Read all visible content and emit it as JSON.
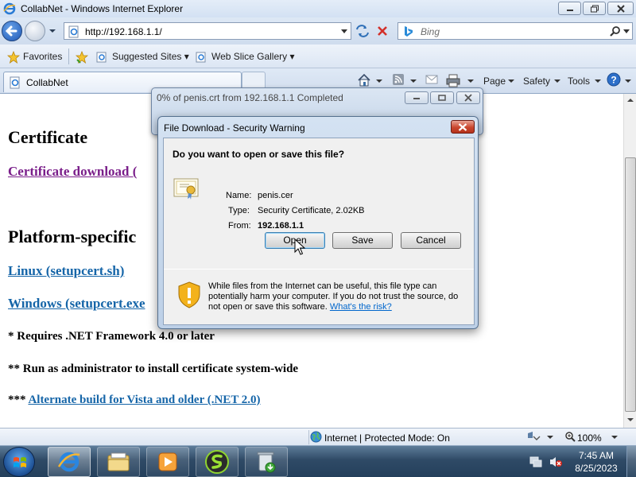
{
  "window": {
    "title": "CollabNet - Windows Internet Explorer"
  },
  "address_bar": {
    "url": "http://192.168.1.1/",
    "search_placeholder": "Bing"
  },
  "favorites_bar": {
    "favorites_label": "Favorites",
    "items": [
      {
        "label": "Suggested Sites ▾",
        "icon": "ie-page-icon"
      },
      {
        "label": "Web Slice Gallery ▾",
        "icon": "ie-page-icon"
      }
    ]
  },
  "tab": {
    "label": "CollabNet"
  },
  "command_bar": {
    "page": "Page",
    "safety": "Safety",
    "tools": "Tools"
  },
  "content": {
    "heading_certificate": "Certificate",
    "link_certificate_download": "Certificate download (",
    "heading_platform": "Platform-specific",
    "link_linux": "Linux (setupcert.sh)",
    "link_windows": "Windows (setupcert.exe",
    "note_net": "* Requires .NET Framework 4.0 or later",
    "note_admin": "** Run as administrator to install certificate system-wide",
    "note_alt_prefix": "***",
    "link_alt_build": "Alternate build for Vista and older (.NET 2.0)"
  },
  "status_bar": {
    "zone": "Internet | Protected Mode: On",
    "zoom": "100%"
  },
  "taskbar": {
    "time": "7:45 AM",
    "date": "8/25/2023",
    "apps": [
      "internet-explorer",
      "file-explorer",
      "media-player",
      "green-s-app",
      "recycle-app"
    ]
  },
  "progress_dialog": {
    "title": "0% of penis.crt from 192.168.1.1 Completed"
  },
  "security_dialog": {
    "title": "File Download - Security Warning",
    "question": "Do you want to open or save this file?",
    "name_label": "Name:",
    "name_value": "penis.cer",
    "type_label": "Type:",
    "type_value": "Security Certificate, 2.02KB",
    "from_label": "From:",
    "from_value": "192.168.1.1",
    "open_button": "Open",
    "save_button": "Save",
    "cancel_button": "Cancel",
    "warning_text": "While files from the Internet can be useful, this file type can potentially harm your computer. If you do not trust the source, do not open or save this software.",
    "risk_link": "What's the risk?"
  },
  "colors": {
    "link": "#1565a8",
    "visited_link": "#7a1e8a",
    "dialog_frame": "#bdd0e7",
    "close_button": "#c9472f",
    "taskbar": "#2f4a66"
  }
}
